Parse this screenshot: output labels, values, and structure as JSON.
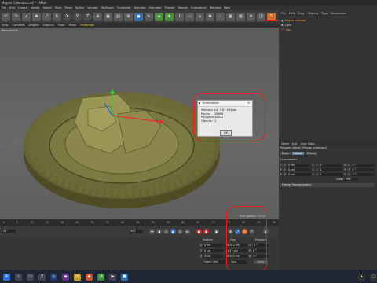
{
  "window": {
    "title": "Mayan Calendar.c4d * - Main"
  },
  "menubar": {
    "items": [
      "File",
      "Edit",
      "Create",
      "Modes",
      "Select",
      "Tools",
      "Mesh",
      "Spline",
      "Volume",
      "MoGraph",
      "Character",
      "Animate",
      "Simulate",
      "Tracker",
      "Render",
      "Extensions",
      "Window",
      "Help"
    ]
  },
  "toolbar": {
    "xyz": [
      "X",
      "Y",
      "Z"
    ]
  },
  "viewport_menu": {
    "items": [
      "View",
      "Cameras",
      "Display",
      "Options",
      "Filter",
      "Panel",
      "ProRender"
    ],
    "label": "Perspective",
    "grid_spacing": "Grid Spacing : 10 cm"
  },
  "object_manager": {
    "menu": [
      "File",
      "Edit",
      "View",
      "Objects",
      "Tags",
      "Bookmarks"
    ],
    "rows": [
      "Mayan calendar",
      "Light",
      "Sky"
    ]
  },
  "info_dialog": {
    "title": "Information",
    "rows": [
      {
        "label": "Memory:",
        "value": "ca. 9.61 KBytes"
      },
      {
        "label": "Points:",
        "value": "28896"
      },
      {
        "label": "Polygons:",
        "value": "28422"
      },
      {
        "label": "Objects:",
        "value": "1"
      }
    ],
    "ok": "OK"
  },
  "attributes": {
    "menu": [
      "Mode",
      "Edit",
      "User Data"
    ],
    "title": "Polygon Object [Mayan calendar]",
    "tabs": [
      "Basic",
      "Coord.",
      "Phong"
    ],
    "section": "Coordinates",
    "rows": [
      {
        "a": "P . X",
        "av": "0 cm",
        "b": "S . X",
        "bv": "1",
        "c": "R . H",
        "cv": "0 °"
      },
      {
        "a": "P . Y",
        "av": "0 cm",
        "b": "S . Y",
        "bv": "1",
        "c": "R . P",
        "cv": "0 °"
      },
      {
        "a": "P . Z",
        "av": "0 cm",
        "b": "S . Z",
        "bv": "1",
        "c": "R . B",
        "cv": "0 °"
      }
    ],
    "order_label": "Order",
    "order_value": "HPB",
    "freeze": "Freeze Transformation"
  },
  "timeline": {
    "ticks": [
      "0",
      "5",
      "10",
      "15",
      "20",
      "25",
      "30",
      "35",
      "40",
      "45",
      "50",
      "55",
      "60",
      "65",
      "70",
      "75",
      "80",
      "85",
      "90"
    ],
    "frame": "0 F",
    "start": "0 F",
    "end": "90 F"
  },
  "coordinates": {
    "headers": [
      "Position",
      "Size",
      "Rotation"
    ],
    "rows": [
      {
        "axis": "X",
        "pos": "0 cm",
        "size": "18.972 cm",
        "rlabel": "H",
        "rot": "0 °"
      },
      {
        "axis": "Y",
        "pos": "0 cm",
        "size": "1.637 cm",
        "rlabel": "P",
        "rot": "0 °"
      },
      {
        "axis": "Z",
        "pos": "0 cm",
        "size": "18.952 cm",
        "rlabel": "B",
        "rot": "0 °"
      }
    ],
    "mode": "Object (Rel)",
    "size_mode": "Size",
    "apply": "Apply"
  },
  "colors": {
    "annotation": "#e02020",
    "accent": "#3c6fb0"
  }
}
